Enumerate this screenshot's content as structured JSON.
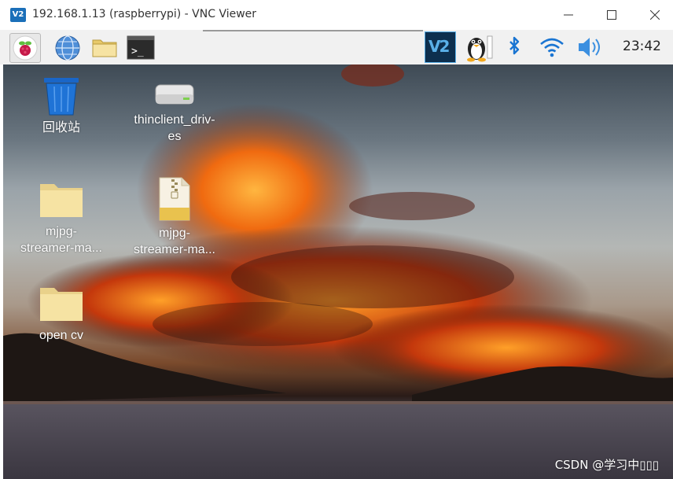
{
  "window": {
    "app_icon_text": "V2",
    "title": "192.168.1.13 (raspberrypi) - VNC Viewer"
  },
  "panel": {
    "launchers": [
      {
        "name": "raspberry-menu-icon"
      },
      {
        "name": "web-browser-icon"
      },
      {
        "name": "file-manager-icon"
      },
      {
        "name": "terminal-icon"
      }
    ],
    "tray": {
      "vnc_text": "V2",
      "clock": "23:42"
    }
  },
  "desktop": {
    "items": [
      {
        "id": "trash",
        "label": "回收站",
        "icon": "trash-icon"
      },
      {
        "id": "drive",
        "label": "thinclient_drives",
        "display": [
          "thinclient_driv-",
          "es"
        ],
        "icon": "drive-icon"
      },
      {
        "id": "folder1",
        "label": "mjpg-streamer-master",
        "display": [
          "mjpg-",
          "streamer-ma..."
        ],
        "icon": "folder-icon"
      },
      {
        "id": "zip1",
        "label": "mjpg-streamer-master",
        "display": [
          "mjpg-",
          "streamer-ma..."
        ],
        "icon": "zip-archive-icon"
      },
      {
        "id": "folder2",
        "label": "open cv",
        "icon": "folder-icon"
      }
    ],
    "watermark": "CSDN @学习中▯▯▯"
  },
  "colors": {
    "panel_bg": "#f1f1f1",
    "vnc_tray_bg": "#0d2f4e",
    "bluetooth": "#1a75d2",
    "folder": "#f6e3a3"
  }
}
